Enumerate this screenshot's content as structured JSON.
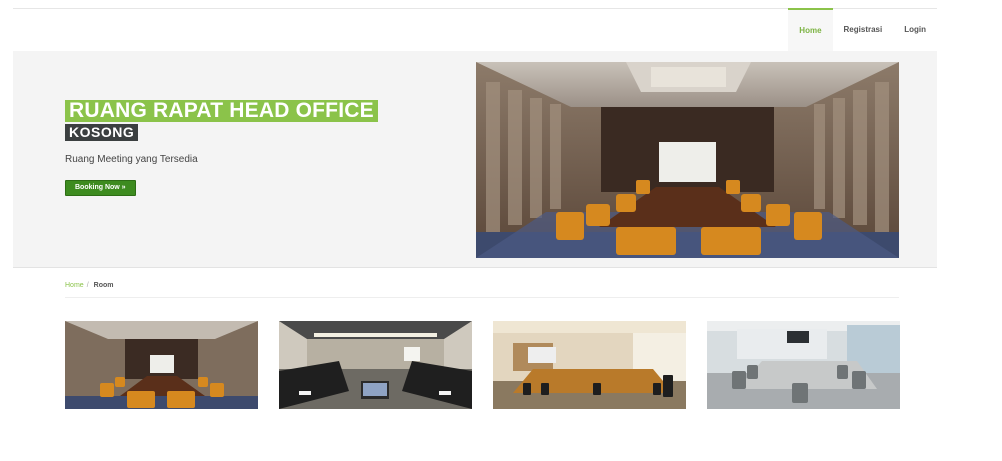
{
  "nav": {
    "items": [
      {
        "label": "Home",
        "active": true
      },
      {
        "label": "Registrasi",
        "active": false
      },
      {
        "label": "Login",
        "active": false
      }
    ]
  },
  "hero": {
    "title": "RUANG RAPAT HEAD OFFICE",
    "status": "KOSONG",
    "subtitle": "Ruang Meeting yang Tersedia",
    "button_label": "Booking Now »",
    "image": "conference-room-photo"
  },
  "breadcrumb": {
    "home": "Home",
    "separator": "/",
    "current": "Room"
  },
  "rooms": [
    {
      "image": "conference-room-orange-chairs"
    },
    {
      "image": "classroom-style-meeting-room"
    },
    {
      "image": "boardroom-long-wooden-table"
    },
    {
      "image": "modern-meeting-room-gray-chairs"
    }
  ],
  "colors": {
    "accent": "#8bc34a",
    "button": "#3d8b1f",
    "status_bg": "#3b3f40"
  }
}
